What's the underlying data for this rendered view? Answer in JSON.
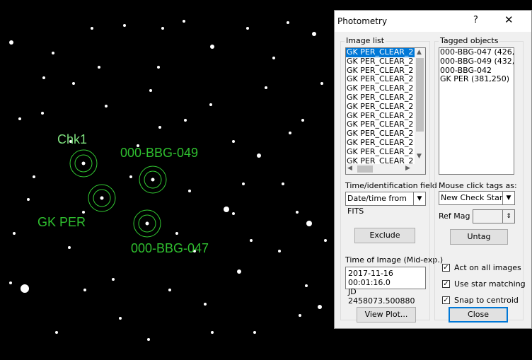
{
  "sky": {
    "stars": [
      [
        16,
        60,
        3
      ],
      [
        35,
        408,
        6
      ],
      [
        40,
        282,
        2
      ],
      [
        62,
        110,
        2
      ],
      [
        150,
        150,
        2
      ],
      [
        195,
        206,
        2
      ],
      [
        226,
        180,
        2
      ],
      [
        268,
        270,
        2
      ],
      [
        262,
        170,
        2
      ],
      [
        300,
        66,
        3
      ],
      [
        320,
        296,
        4
      ],
      [
        330,
        302,
        2
      ],
      [
        344,
        260,
        2
      ],
      [
        366,
        220,
        3
      ],
      [
        376,
        124,
        2
      ],
      [
        407,
        32,
        2
      ],
      [
        428,
        170,
        2
      ],
      [
        437,
        316,
        4
      ],
      [
        444,
        48,
        3
      ],
      [
        452,
        434,
        3
      ],
      [
        433,
        404,
        2
      ],
      [
        424,
        446,
        2
      ],
      [
        338,
        384,
        3
      ],
      [
        224,
        95,
        2
      ],
      [
        213,
        128,
        2
      ],
      [
        104,
        118,
        2
      ],
      [
        75,
        75,
        2
      ],
      [
        260,
        30,
        2
      ],
      [
        130,
        40,
        2
      ],
      [
        176,
        36,
        2
      ],
      [
        410,
        188,
        2
      ],
      [
        387,
        82,
        2
      ],
      [
        298,
        148,
        2
      ],
      [
        250,
        330,
        2
      ],
      [
        118,
        300,
        2
      ],
      [
        28,
        168,
        2
      ],
      [
        170,
        450,
        2
      ],
      [
        80,
        470,
        2
      ],
      [
        290,
        430,
        2
      ],
      [
        360,
        470,
        2
      ],
      [
        210,
        480,
        2
      ],
      [
        120,
        410,
        2
      ],
      [
        400,
        260,
        2
      ],
      [
        460,
        340,
        2
      ],
      [
        455,
        118,
        2
      ],
      [
        15,
        400,
        2
      ],
      [
        48,
        250,
        2
      ],
      [
        20,
        330,
        2
      ],
      [
        98,
        350,
        2
      ],
      [
        160,
        395,
        2
      ],
      [
        185,
        250,
        2
      ],
      [
        240,
        410,
        2
      ],
      [
        330,
        200,
        2
      ],
      [
        355,
        340,
        2
      ],
      [
        420,
        300,
        2
      ],
      [
        300,
        470,
        2
      ],
      [
        230,
        40,
        2
      ],
      [
        350,
        40,
        2
      ],
      [
        140,
        95,
        2
      ],
      [
        100,
        200,
        2
      ],
      [
        60,
        160,
        2
      ],
      [
        395,
        355,
        2
      ],
      [
        275,
        355,
        2
      ]
    ],
    "targets": [
      {
        "name": "Chk1"
      },
      {
        "name": "000-BBG-049"
      },
      {
        "name": "GK PER"
      },
      {
        "name": "000-BBG-047"
      }
    ]
  },
  "dialog": {
    "title": "Photometry",
    "help_label": "?",
    "close_glyph": "✕",
    "image_list_label": "Image list",
    "image_list": [
      "GK PER_CLEAR_2",
      "GK PER_CLEAR_2",
      "GK PER_CLEAR_2",
      "GK PER_CLEAR_2",
      "GK PER_CLEAR_2",
      "GK PER_CLEAR_2",
      "GK PER_CLEAR_2",
      "GK PER_CLEAR_2",
      "GK PER_CLEAR_2",
      "GK PER_CLEAR_2",
      "GK PER_CLEAR_2",
      "GK PER_CLEAR_2",
      "GK PER_CLEAR_2",
      "GK PER_CLEAR_2",
      "GK PER_CLEAR_2",
      "GK PER_CLEAR_2"
    ],
    "tagged_objects_label": "Tagged objects",
    "tagged_objects": [
      "000-BBG-047 (426,27",
      "000-BBG-049 (432,23",
      "000-BBG-042",
      "GK PER (381,250)"
    ],
    "time_field_label": "Time/identification field",
    "time_field_value": "Date/time from FITS",
    "exclude_label": "Exclude",
    "time_of_image_label": "Time of Image (Mid-exp.)",
    "time_of_image_lines": [
      "2017-11-16  00:01:16.0",
      "JD 2458073.500880"
    ],
    "mouse_click_label": "Mouse click tags as:",
    "mouse_click_value": "New Check Star",
    "ref_mag_label": "Ref Mag",
    "ref_mag_value": "",
    "untag_label": "Untag",
    "checkboxes": [
      {
        "label": "Act on all images",
        "checked": true
      },
      {
        "label": "Use star matching",
        "checked": true
      },
      {
        "label": "Snap to centroid",
        "checked": true
      }
    ],
    "view_plot_label": "View Plot...",
    "close_label": "Close",
    "colors": {
      "selection": "#0078d7",
      "target_green": "#33cc33",
      "label_green": "#2fbf2f"
    }
  }
}
